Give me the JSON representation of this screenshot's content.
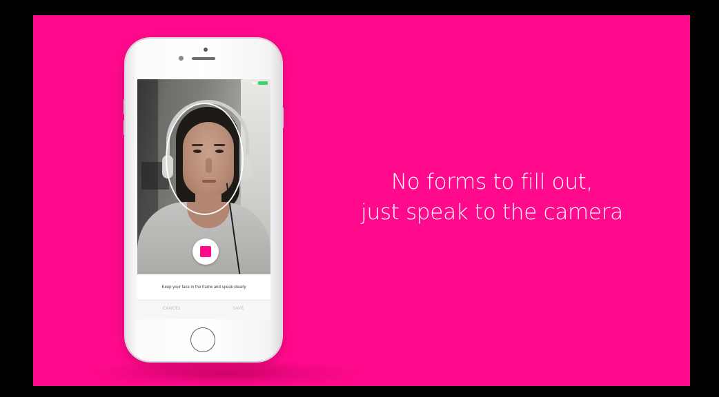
{
  "slide": {
    "background_color": "#ff0a8c",
    "headline_line1": "No forms to fill out,",
    "headline_line2": "just speak to the camera"
  },
  "phone_app": {
    "status_bar": {
      "battery_color": "#3cd36a"
    },
    "camera_view": {
      "face_guide": "face-oval-guide"
    },
    "record_button": {
      "icon": "stop-icon",
      "color": "#ff0a8c"
    },
    "instructions": "Keep your face in the frame and speak clearly",
    "actions": {
      "cancel_label": "CANCEL",
      "save_label": "SAVE"
    }
  }
}
